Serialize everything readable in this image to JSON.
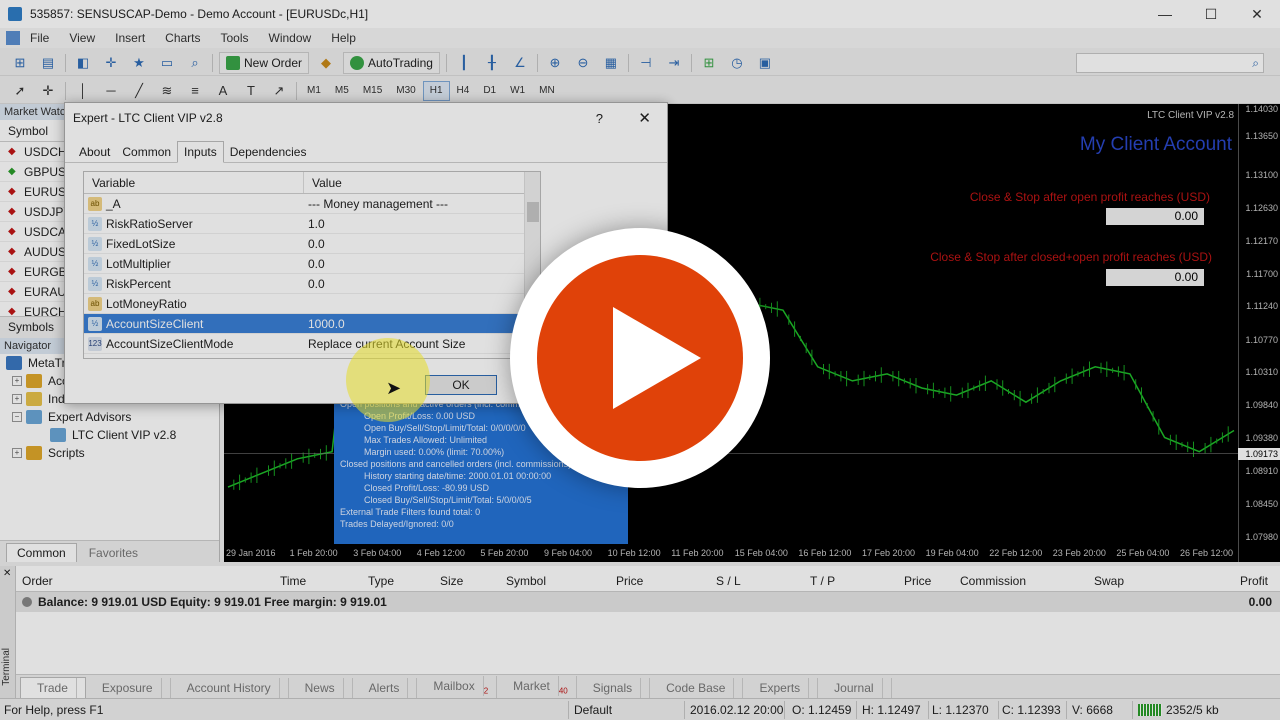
{
  "window": {
    "title": "535857: SENSUSCAP-Demo - Demo Account - [EURUSDc,H1]"
  },
  "menu": [
    "File",
    "View",
    "Insert",
    "Charts",
    "Tools",
    "Window",
    "Help"
  ],
  "toolbar": {
    "new_order": "New Order",
    "autotrading": "AutoTrading",
    "timeframes": [
      "M1",
      "M5",
      "M15",
      "M30",
      "H1",
      "H4",
      "D1",
      "W1",
      "MN"
    ],
    "active_timeframe": "H1"
  },
  "market_watch": {
    "header": "Market Watch",
    "column": "Symbol",
    "symbols": [
      {
        "name": "USDCHF",
        "dir": "down"
      },
      {
        "name": "GBPUSD",
        "dir": "up"
      },
      {
        "name": "EURUSD",
        "dir": "down"
      },
      {
        "name": "USDJPY",
        "dir": "down"
      },
      {
        "name": "USDCAD",
        "dir": "down"
      },
      {
        "name": "AUDUSD",
        "dir": "down"
      },
      {
        "name": "EURGBP",
        "dir": "down"
      },
      {
        "name": "EURAUD",
        "dir": "down"
      },
      {
        "name": "EURCHF",
        "dir": "down"
      }
    ],
    "tab": "Symbols"
  },
  "navigator": {
    "header": "Navigator",
    "items": [
      "MetaTrader 4",
      "Accounts",
      "Indicators",
      "Expert Advisors",
      "LTC Client VIP v2.8",
      "Scripts"
    ],
    "tabs": [
      "Common",
      "Favorites"
    ]
  },
  "dialog": {
    "title": "Expert - LTC Client VIP v2.8",
    "help": "?",
    "close": "✕",
    "tabs": [
      "About",
      "Common",
      "Inputs",
      "Dependencies"
    ],
    "active_tab": "Inputs",
    "columns": [
      "Variable",
      "Value"
    ],
    "rows": [
      {
        "type": "ab",
        "var": "_A",
        "val": "--- Money management ---"
      },
      {
        "type": "num",
        "var": "RiskRatioServer",
        "val": "1.0"
      },
      {
        "type": "num",
        "var": "FixedLotSize",
        "val": "0.0"
      },
      {
        "type": "num",
        "var": "LotMultiplier",
        "val": "0.0"
      },
      {
        "type": "num",
        "var": "RiskPercent",
        "val": "0.0"
      },
      {
        "type": "ab",
        "var": "LotMoneyRatio",
        "val": ""
      },
      {
        "type": "num",
        "var": "AccountSizeClient",
        "val": "1000.0",
        "selected": true
      },
      {
        "type": "enum",
        "var": "AccountSizeClientMode",
        "val": "Replace current Account Size"
      }
    ],
    "ok": "OK"
  },
  "chart": {
    "ea_label": "LTC Client VIP v2.8",
    "title": "My Client Account",
    "label1": "Close & Stop after open profit reaches (USD)",
    "value1": "0.00",
    "label2": "Close & Stop after closed+open profit reaches (USD)",
    "value2": "0.00",
    "current_price": "1.09173",
    "panel_lines": [
      "Open positions and active orders (incl. commissions):",
      "Open Profit/Loss: 0.00 USD",
      "Open Buy/Sell/Stop/Limit/Total: 0/0/0/0/0",
      "Max Trades Allowed: Unlimited",
      "Margin used: 0.00% (limit: 70.00%)",
      "Closed positions and cancelled orders (incl. commissions):",
      "History starting date/time: 2000.01.01 00:00:00",
      "Closed Profit/Loss: -80.99 USD",
      "Closed Buy/Sell/Stop/Limit/Total: 5/0/0/0/5",
      "External Trade Filters found total: 0",
      "Trades Delayed/Ignored: 0/0"
    ]
  },
  "chart_data": {
    "type": "line",
    "y_ticks": [
      "1.14030",
      "1.13650",
      "1.13100",
      "1.12630",
      "1.12170",
      "1.11700",
      "1.11240",
      "1.10770",
      "1.10310",
      "1.09840",
      "1.09380",
      "1.08910",
      "1.08450",
      "1.07980"
    ],
    "x_ticks": [
      "29 Jan 2016",
      "1 Feb 20:00",
      "3 Feb 04:00",
      "4 Feb 12:00",
      "5 Feb 20:00",
      "9 Feb 04:00",
      "10 Feb 12:00",
      "11 Feb 20:00",
      "15 Feb 04:00",
      "16 Feb 12:00",
      "17 Feb 20:00",
      "19 Feb 04:00",
      "22 Feb 12:00",
      "23 Feb 20:00",
      "25 Feb 04:00",
      "26 Feb 12:00"
    ],
    "ylim": [
      1.0798,
      1.1403
    ],
    "series": [
      {
        "values": [
          1.087,
          1.089,
          1.091,
          1.092,
          1.136,
          1.128,
          1.122,
          1.118,
          1.116,
          1.117,
          1.114,
          1.113,
          1.115,
          1.112,
          1.114,
          1.113,
          1.112,
          1.104,
          1.102,
          1.103,
          1.101,
          1.1,
          1.102,
          1.099,
          1.102,
          1.104,
          1.103,
          1.094,
          1.092,
          1.095
        ]
      }
    ]
  },
  "terminal": {
    "columns": [
      "Order",
      "Time",
      "Type",
      "Size",
      "Symbol",
      "Price",
      "S / L",
      "T / P",
      "Price",
      "Commission",
      "Swap",
      "Profit"
    ],
    "balance": "Balance: 9 919.01 USD  Equity: 9 919.01  Free margin: 9 919.01",
    "profit": "0.00",
    "tabs": [
      {
        "label": "Trade",
        "badge": ""
      },
      {
        "label": "Exposure",
        "badge": ""
      },
      {
        "label": "Account History",
        "badge": ""
      },
      {
        "label": "News",
        "badge": ""
      },
      {
        "label": "Alerts",
        "badge": ""
      },
      {
        "label": "Mailbox",
        "badge": "2"
      },
      {
        "label": "Market",
        "badge": "40"
      },
      {
        "label": "Signals",
        "badge": ""
      },
      {
        "label": "Code Base",
        "badge": ""
      },
      {
        "label": "Experts",
        "badge": ""
      },
      {
        "label": "Journal",
        "badge": ""
      }
    ],
    "side_label": "Terminal"
  },
  "status": {
    "help": "For Help, press F1",
    "profile": "Default",
    "time": "2016.02.12 20:00",
    "open": "O: 1.12459",
    "high": "H: 1.12497",
    "low": "L: 1.12370",
    "close": "C: 1.12393",
    "volume": "V: 6668",
    "traffic": "2352/5 kb"
  }
}
